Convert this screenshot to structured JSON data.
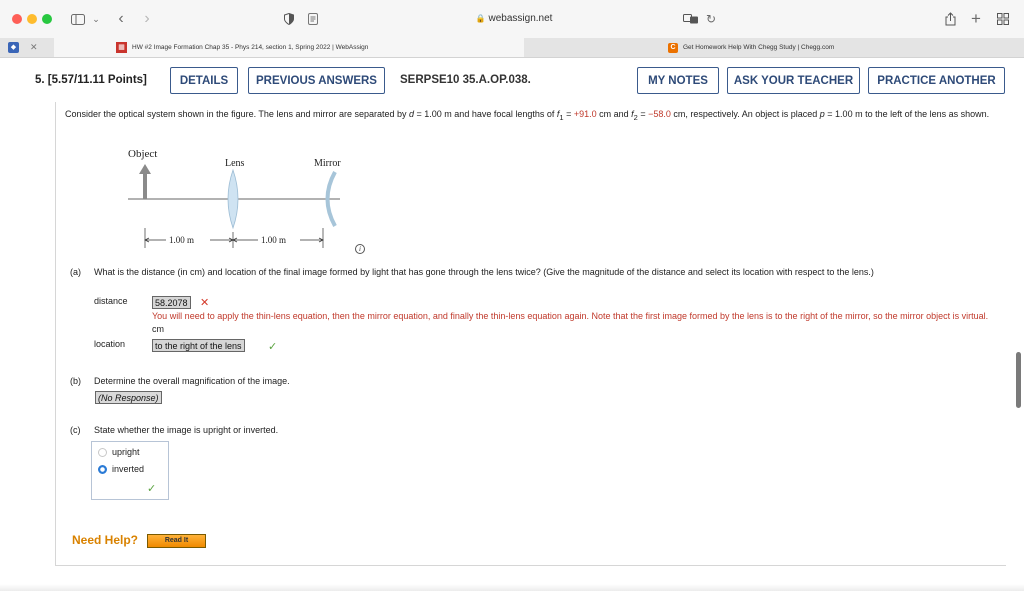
{
  "browser": {
    "url": "webassign.net",
    "tabs": [
      {
        "label": "HW #2 Image Formation Chap 35 - Phys 214, section 1, Spring 2022 | WebAssign",
        "active": true
      },
      {
        "label": "Get Homework Help With Chegg Study | Chegg.com",
        "active": false
      }
    ],
    "icons": [
      "sidebar-icon",
      "chevron-down-icon",
      "back-icon",
      "forward-icon",
      "shield-icon",
      "reader-icon",
      "lock-icon",
      "translate-icon",
      "reload-icon",
      "share-icon",
      "plus-icon",
      "tab-overview-icon",
      "close-icon"
    ]
  },
  "question": {
    "number": "5.",
    "points": "[5.57/11.11 Points]",
    "code": "SERPSE10 35.A.OP.038.",
    "buttons": {
      "details": "DETAILS",
      "previous_answers": "PREVIOUS ANSWERS",
      "my_notes": "MY NOTES",
      "ask_teacher": "ASK YOUR TEACHER",
      "practice_another": "PRACTICE ANOTHER"
    },
    "problem": {
      "t1": "Consider the optical system shown in the figure. The lens and mirror are separated by ",
      "d_var": "d",
      "t2": " = 1.00 m and have focal lengths of ",
      "f1_var": "f",
      "f1_sub": "1",
      "t3": " = ",
      "f1_val": "+91.0",
      "t4": " cm and ",
      "f2_var": "f",
      "f2_sub": "2",
      "t5": " = ",
      "f2_val": "−58.0",
      "t6": " cm, respectively. An object is placed ",
      "p_var": "p",
      "t7": " = 1.00 m to the left of the lens as shown."
    },
    "figure": {
      "object_label": "Object",
      "lens_label": "Lens",
      "mirror_label": "Mirror",
      "dist1": "1.00 m",
      "dist2": "1.00 m",
      "info_icon": "i"
    },
    "part_a": {
      "label": "(a)",
      "text": "What is the distance (in cm) and location of the final image formed by light that has gone through the lens twice? (Give the magnitude of the distance and select its location with respect to the lens.)",
      "distance_label": "distance",
      "distance_value": "58.2078",
      "distance_mark": "✕",
      "feedback": "You will need to apply the thin-lens equation, then the mirror equation, and finally the thin-lens equation again. Note that the first image formed by the lens is to the right of the mirror, so the mirror object is virtual.",
      "unit": "cm",
      "location_label": "location",
      "location_value": "to the right of the lens",
      "location_mark": "✓"
    },
    "part_b": {
      "label": "(b)",
      "text": "Determine the overall magnification of the image.",
      "value": "(No Response)"
    },
    "part_c": {
      "label": "(c)",
      "text": "State whether the image is upright or inverted.",
      "options": [
        "upright",
        "inverted"
      ],
      "selected": "inverted",
      "mark": "✓"
    },
    "help": {
      "label": "Need Help?",
      "read_it": "Read It"
    }
  },
  "colors": {
    "button_border": "#3a5a8c",
    "incorrect": "#d43a2a",
    "correct": "#5aa340",
    "feedback_red": "#c0392b",
    "need_help_orange": "#d98200"
  }
}
